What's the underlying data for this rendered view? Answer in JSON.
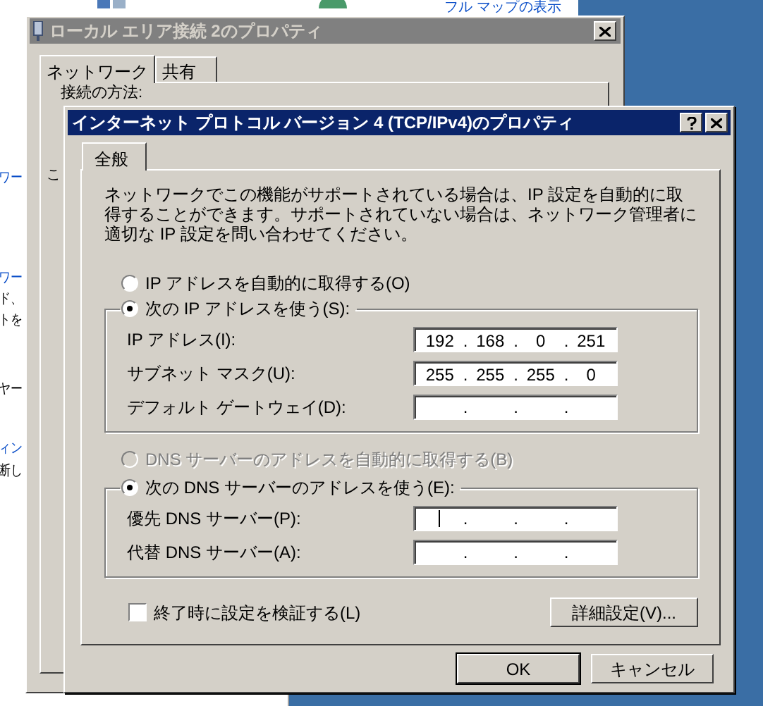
{
  "background": {
    "link": "フル マップの表示",
    "fragments": [
      {
        "text": "ワー",
        "kind": "link"
      },
      {
        "text": "ワー",
        "kind": "link"
      },
      {
        "text": "ド、",
        "kind": "text"
      },
      {
        "text": "トを",
        "kind": "text"
      },
      {
        "text": "ヤー",
        "kind": "text"
      },
      {
        "text": "ィン",
        "kind": "link"
      },
      {
        "text": "断し",
        "kind": "text"
      }
    ]
  },
  "back_dialog": {
    "title": "ローカル エリア接続 2のプロパティ",
    "tabs": [
      {
        "label": "ネットワーク",
        "selected": true
      },
      {
        "label": "共有",
        "selected": false
      }
    ],
    "label": "接続の方法:",
    "fragment": "こ"
  },
  "dialog": {
    "title": "インターネット プロトコル バージョン 4 (TCP/IPv4)のプロパティ",
    "tabs": [
      {
        "label": "全般",
        "selected": true
      }
    ],
    "description": "ネットワークでこの機能がサポートされている場合は、IP 設定を自動的に取得することができます。サポートされていない場合は、ネットワーク管理者に適切な IP 設定を問い合わせてください。",
    "separator": ".",
    "ip_options": [
      {
        "label": "IP アドレスを自動的に取得する(O)",
        "selected": false,
        "disabled": false
      },
      {
        "label": "次の IP アドレスを使う(S):",
        "selected": true,
        "disabled": false
      }
    ],
    "ip_fields": [
      {
        "label": "IP アドレス(I):",
        "octets": [
          "192",
          "168",
          "0",
          "251"
        ],
        "focused": false
      },
      {
        "label": "サブネット マスク(U):",
        "octets": [
          "255",
          "255",
          "255",
          "0"
        ],
        "focused": false
      },
      {
        "label": "デフォルト ゲートウェイ(D):",
        "focused": false
      }
    ],
    "dns_options": [
      {
        "label": "DNS サーバーのアドレスを自動的に取得する(B)",
        "selected": false,
        "disabled": true
      },
      {
        "label": "次の DNS サーバーのアドレスを使う(E):",
        "selected": true,
        "disabled": false
      }
    ],
    "dns_fields": [
      {
        "label": "優先 DNS サーバー(P):",
        "focused": true
      },
      {
        "label": "代替 DNS サーバー(A):",
        "focused": false
      }
    ],
    "validate": {
      "label": "終了時に設定を検証する(L)",
      "checked": false
    },
    "advanced_button": "詳細設定(V)...",
    "buttons": [
      {
        "label": "OK",
        "default": true
      },
      {
        "label": "キャンセル",
        "default": false
      }
    ]
  }
}
